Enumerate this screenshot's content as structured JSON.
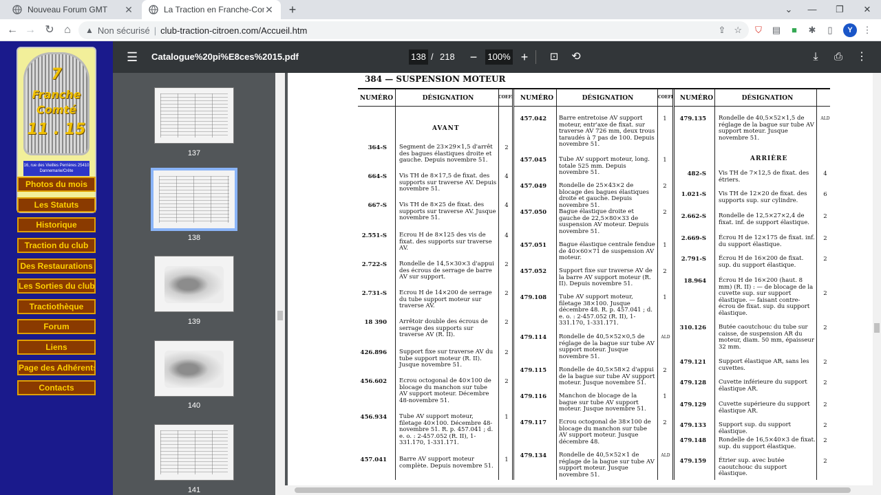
{
  "browser": {
    "tabs": [
      {
        "title": "Nouveau Forum GMT",
        "active": false
      },
      {
        "title": "La Traction en Franche-Comté",
        "active": true
      }
    ],
    "security_label": "Non sécurisé",
    "url": "club-traction-citroen.com/Accueil.htm",
    "profile_initial": "Y"
  },
  "site": {
    "logo": {
      "line1": "7",
      "line2": "Franche",
      "line3": "Comté",
      "line4": "11 . 15",
      "address": "16, rue des Vieilles Perrières 25410 Dannemarie/Crête"
    },
    "nav": [
      "Photos du mois",
      "Les Statuts",
      "Historique",
      "Traction du club",
      "Des Restaurations",
      "Les Sorties du club",
      "Tractiothèque",
      "Forum",
      "Liens",
      "Page des Adhérents",
      "Contacts"
    ],
    "colors": {
      "background": "#1a1a8c",
      "button": "#8a3a00",
      "button_text": "#ffd000"
    }
  },
  "pdf": {
    "filename": "Catalogue%20pi%E8ces%2015.pdf",
    "current_page": "138",
    "page_separator": "/",
    "total_pages": "218",
    "zoom": "100%",
    "thumbnails": [
      "137",
      "138",
      "139",
      "140",
      "141"
    ],
    "heading": "384 — SUSPENSION MOTEUR",
    "headers": {
      "numero": "NUMÉRO",
      "designation": "DÉSIGNATION",
      "coeff": "COEFF"
    },
    "col1": {
      "section": "AVANT",
      "rows": [
        {
          "ref": "364-S",
          "desc": "Segment de 23×29×1,5 d'arrêt des bagues élastiques droite et gauche. Depuis novembre 51.",
          "qty": "2"
        },
        {
          "ref": "664-S",
          "desc": "Vis TH de 8×17,5 de fixat. des supports sur traverse AV. Depuis novembre 51.",
          "qty": "4"
        },
        {
          "ref": "667-S",
          "desc": "Vis TH de 8×25 de fixat. des supports sur traverse AV. Jusque novembre 51.",
          "qty": "4"
        },
        {
          "ref": "2.551-S",
          "desc": "Ecrou H de 8×125 des vis de fixat. des supports sur traverse AV.",
          "qty": "4"
        },
        {
          "ref": "2.722-S",
          "desc": "Rondelle de 14,5×30×3 d'appui des écrous de serrage de barre AV sur support.",
          "qty": "2"
        },
        {
          "ref": "2.731-S",
          "desc": "Ecrou H de 14×200 de serrage du tube support moteur sur traverse AV.",
          "qty": "2"
        },
        {
          "ref": "18 390",
          "desc": "Arrêtoir double des écrous de serrage des supports sur traverse AV (R. II).",
          "qty": "2"
        },
        {
          "ref": "426.896",
          "desc": "Support fixe sur traverse AV du tube support moteur (R. II). Jusque novembre 51.",
          "qty": "2"
        },
        {
          "ref": "456.602",
          "desc": "Ecrou octogonal de 40×100 de blocage du manchon sur tube AV support moteur. Décembre 48-novembre 51.",
          "qty": "2"
        },
        {
          "ref": "456.934",
          "desc": "Tube AV support moteur, filetage 40×100. Décembre 48-novembre 51. R. p. 457.041 ; d. e. o. : 2-457.052 (R. II), 1-331.170, 1-331.171.",
          "qty": "1"
        },
        {
          "ref": "457.041",
          "desc": "Barre AV support moteur complète. Depuis novembre 51.",
          "qty": "1"
        }
      ]
    },
    "col2": {
      "rows": [
        {
          "ref": "457.042",
          "desc": "Barre entretoise AV support moteur, entr'axe de fixat. sur traverse AV 726 mm, deux trous taraudés à 7 pas de 100. Depuis novembre 51.",
          "qty": "1"
        },
        {
          "ref": "457.045",
          "desc": "Tube AV support moteur, long. totale 525 mm. Depuis novembre 51.",
          "qty": "1"
        },
        {
          "ref": "457.049",
          "desc": "Rondelle de 25×43×2 de blocage des bagues élastiques droite et gauche. Depuis novembre 51.",
          "qty": "2"
        },
        {
          "ref": "457.050",
          "desc": "Bague élastique droite et gauche de 22,5×80×33 de suspension AV moteur. Depuis novembre 51.",
          "qty": "2"
        },
        {
          "ref": "457.051",
          "desc": "Bague élastique centrale fendue de 40×60×71 de suspension AV moteur.",
          "qty": "1"
        },
        {
          "ref": "457.052",
          "desc": "Support fixe sur traverse AV de la barre AV support moteur (R. II). Depuis novembre 51.",
          "qty": "2"
        },
        {
          "ref": "479.108",
          "desc": "Tube AV support moteur, filetage 38×100. Jusque décembre 48. R. p. 457.041 ; d. e. o. : 2-457.052 (R. II), 1-331.170, 1-331.171.",
          "qty": "1"
        },
        {
          "ref": "479.114",
          "desc": "Rondelle de 40,5×52×0,5 de réglage de la bague sur tube AV support moteur. Jusque novembre 51.",
          "qty": "ALD"
        },
        {
          "ref": "479.115",
          "desc": "Rondelle de 40,5×58×2 d'appui de la bague sur tube AV support moteur. Jusque novembre 51.",
          "qty": "2"
        },
        {
          "ref": "479.116",
          "desc": "Manchon de blocage de la bague sur tube AV support moteur. Jusque novembre 51.",
          "qty": "1"
        },
        {
          "ref": "479.117",
          "desc": "Ecrou octogonal de 38×100 de blocage du manchon sur tube AV support moteur. Jusque décembre 48.",
          "qty": "2"
        },
        {
          "ref": "479.134",
          "desc": "Rondelle de 40,5×52×1 de réglage de la bague sur tube AV support moteur. Jusque novembre 51.",
          "qty": "ALD"
        }
      ]
    },
    "col3": {
      "section": "ARRIÈRE",
      "rows": [
        {
          "ref": "479.135",
          "desc": "Rondelle de 40,5×52×1,5 de réglage de la bague sur tube AV support moteur. Jusque novembre 51.",
          "qty": "ALD"
        },
        {
          "ref": "482-S",
          "desc": "Vis TH de 7×12,5 de fixat. des étriers.",
          "qty": "4"
        },
        {
          "ref": "1.021-S",
          "desc": "Vis TH de 12×20 de fixat. des supports sup. sur cylindre.",
          "qty": "6"
        },
        {
          "ref": "2.662-S",
          "desc": "Rondelle de 12,5×27×2,4 de fixat. inf. de support élastique.",
          "qty": "2"
        },
        {
          "ref": "2.669-S",
          "desc": "Écrou H de 12×175 de fixat. inf. du support élastique.",
          "qty": "2"
        },
        {
          "ref": "2.791-S",
          "desc": "Écrou H de 16×200 de fixat. sup. du support élastique.",
          "qty": "2"
        },
        {
          "ref": "18.964",
          "desc": "Écrou H de 16×200 (haut. 8 mm) (R. II) : — de blocage de la cuvette sup. sur support élastique. — faisant contre-écrou de fixat. sup. du support élastique.",
          "qty": "2"
        },
        {
          "ref": "310.126",
          "desc": "Butée caoutchouc du tube sur caisse, de suspension AR du moteur, diam. 50 mm, épaisseur 32 mm.",
          "qty": "2"
        },
        {
          "ref": "479.121",
          "desc": "Support élastique AR, sans les cuvettes.",
          "qty": "2"
        },
        {
          "ref": "479.128",
          "desc": "Cuvette inférieure du support élastique AR.",
          "qty": "2"
        },
        {
          "ref": "479.129",
          "desc": "Cuvette supérieure du support élastique AR.",
          "qty": "2"
        },
        {
          "ref": "479.133",
          "desc": "Support sup. du support élastique.",
          "qty": "2"
        },
        {
          "ref": "479.148",
          "desc": "Rondelle de 16,5×40×3 de fixat. sup. du support élastique.",
          "qty": "2"
        },
        {
          "ref": "479.159",
          "desc": "Étrier sup. avec butée caoutchouc du support élastique.",
          "qty": "2"
        }
      ]
    }
  }
}
